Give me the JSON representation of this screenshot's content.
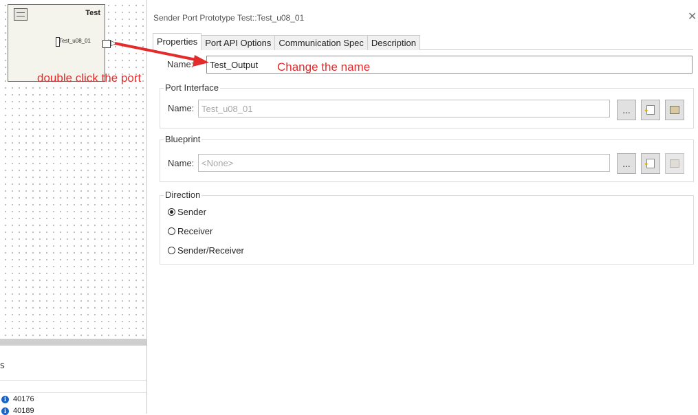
{
  "canvas": {
    "component": {
      "title": "Test",
      "port_label": "Test_u08_01"
    },
    "annotation": "double click the port"
  },
  "bottom_panel": {
    "title": "s",
    "rows": [
      {
        "icon": "info-icon",
        "value": "40176"
      },
      {
        "icon": "info-icon",
        "value": "40189"
      }
    ]
  },
  "dialog": {
    "title": "Sender Port Prototype Test::Test_u08_01",
    "tabs": [
      "Properties",
      "Port API Options",
      "Communication Spec",
      "Description"
    ],
    "active_tab": "Properties",
    "name_label": "Name:",
    "name_value": "Test_Output",
    "port_interface": {
      "title": "Port Interface",
      "name_label": "Name:",
      "name_value": "Test_u08_01",
      "browse_label": "..."
    },
    "blueprint": {
      "title": "Blueprint",
      "name_label": "Name:",
      "name_value": "<None>",
      "browse_label": "..."
    },
    "direction": {
      "title": "Direction",
      "options": [
        "Sender",
        "Receiver",
        "Sender/Receiver"
      ],
      "selected": "Sender"
    }
  },
  "annotation_change": "Change the name",
  "annotation_color": "#e32b2b"
}
